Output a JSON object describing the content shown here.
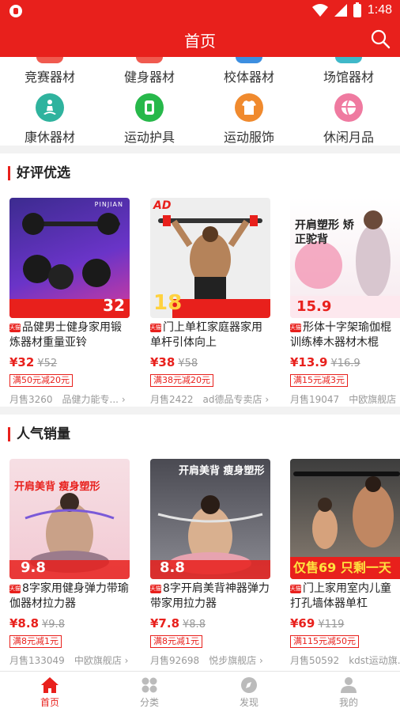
{
  "status_bar": {
    "time": "1:48"
  },
  "header": {
    "title": "首页"
  },
  "categories": [
    {
      "label": "竞赛器材",
      "color": "#f05a4f"
    },
    {
      "label": "健身器材",
      "color": "#f05a4f"
    },
    {
      "label": "校体器材",
      "color": "#3c8ee0"
    },
    {
      "label": "场馆器材",
      "color": "#3fb8c9"
    },
    {
      "label": "康休器材",
      "color": "#2fb39e",
      "icon": "meditation-icon"
    },
    {
      "label": "运动护具",
      "color": "#27b84a",
      "icon": "wristband-icon"
    },
    {
      "label": "运动服饰",
      "color": "#f08a2e",
      "icon": "tshirt-icon"
    },
    {
      "label": "休闲月品",
      "color": "#ef7aa0",
      "icon": "ball-icon"
    }
  ],
  "sections": [
    {
      "title": "好评优选",
      "products": [
        {
          "name": "品健男士健身家用锻炼器材重量亚铃",
          "price": "¥32",
          "old_price": "¥52",
          "coupon": "满50元减20元",
          "sales": "月售3260",
          "shop": "品健力能专...",
          "thumb_caption": "PINJIAN",
          "thumb_price": "32"
        },
        {
          "name": "门上单杠家庭器家用单杆引体向上",
          "price": "¥38",
          "old_price": "¥58",
          "coupon": "满38元减20元",
          "sales": "月售2422",
          "shop": "ad德品专卖店",
          "thumb_caption": "AD",
          "thumb_price": "18"
        },
        {
          "name": "形体十字架瑜伽棍训练棒木器材木棍",
          "price": "¥13.9",
          "old_price": "¥16.9",
          "coupon": "满15元减3元",
          "sales": "月售19047",
          "shop": "中欧旗舰店",
          "thumb_caption": "开肩塑形 矫正驼背",
          "thumb_price": "15.9"
        }
      ]
    },
    {
      "title": "人气销量",
      "products": [
        {
          "name": "8字家用健身弹力带瑜伽器材拉力器",
          "price": "¥8.8",
          "old_price": "¥9.8",
          "coupon": "满8元减1元",
          "sales": "月售133049",
          "shop": "中欧旗舰店",
          "thumb_caption": "开肩美背 瘦身塑形",
          "thumb_price": "9.8"
        },
        {
          "name": "8字开肩美背神器弹力带家用拉力器",
          "price": "¥7.8",
          "old_price": "¥8.8",
          "coupon": "满8元减1元",
          "sales": "月售92698",
          "shop": "悦步旗舰店",
          "thumb_caption": "开肩美背 瘦身塑形",
          "thumb_price": "8.8"
        },
        {
          "name": "门上家用室内儿童打孔墙体器单杠",
          "price": "¥69",
          "old_price": "¥119",
          "coupon": "满115元减50元",
          "sales": "月售50592",
          "shop": "kdst运动旗...",
          "thumb_caption": "仅售69 只剩一天",
          "thumb_price": "69"
        }
      ]
    }
  ],
  "tabs": [
    {
      "label": "首页",
      "icon": "home-icon",
      "active": true
    },
    {
      "label": "分类",
      "icon": "grid-icon"
    },
    {
      "label": "发现",
      "icon": "compass-icon"
    },
    {
      "label": "我的",
      "icon": "person-icon"
    }
  ],
  "colors": {
    "brand": "#e8201c"
  }
}
